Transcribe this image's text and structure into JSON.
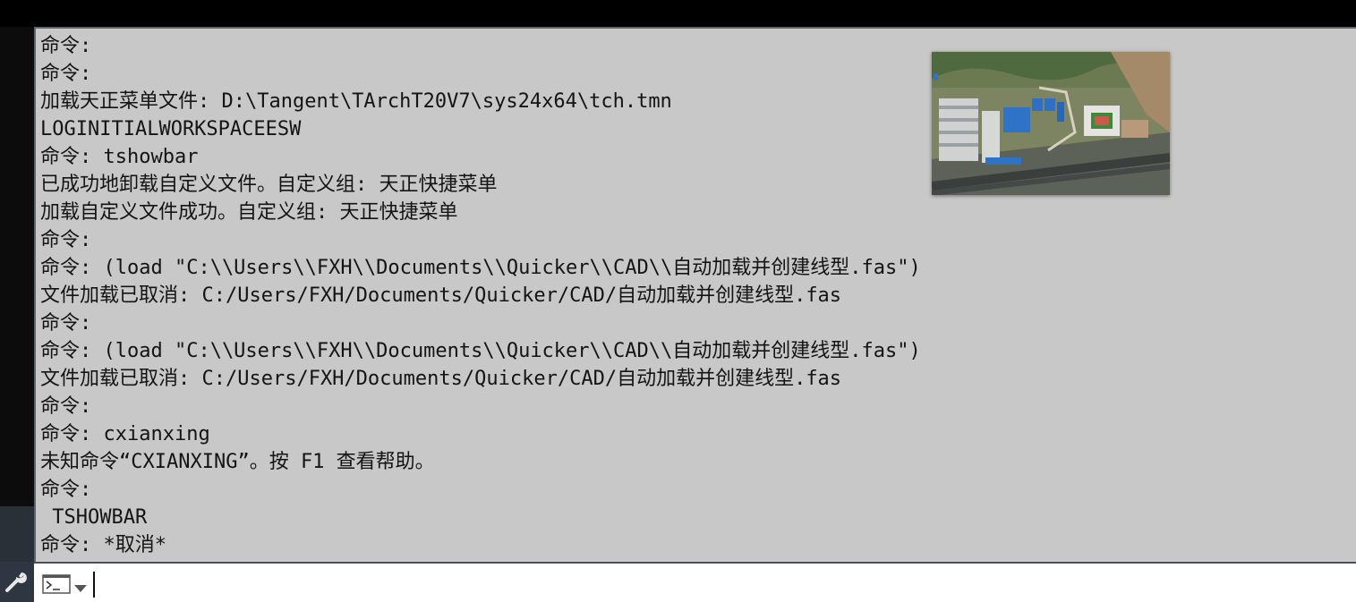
{
  "command_history": [
    "命令:",
    "命令:",
    "加载天正菜单文件: D:\\Tangent\\TArchT20V7\\sys24x64\\tch.tmn",
    "LOGINITIALWORKSPACEESW",
    "命令: tshowbar",
    "已成功地卸载自定义文件。自定义组: 天正快捷菜单",
    "加载自定义文件成功。自定义组: 天正快捷菜单",
    "命令:",
    "命令: (load \"C:\\\\Users\\\\FXH\\\\Documents\\\\Quicker\\\\CAD\\\\自动加载并创建线型.fas\")",
    "文件加载已取消: C:/Users/FXH/Documents/Quicker/CAD/自动加载并创建线型.fas",
    "命令:",
    "命令: (load \"C:\\\\Users\\\\FXH\\\\Documents\\\\Quicker\\\\CAD\\\\自动加载并创建线型.fas\")",
    "文件加载已取消: C:/Users/FXH/Documents/Quicker/CAD/自动加载并创建线型.fas",
    "命令:",
    "命令: cxianxing",
    "未知命令“CXIANXING”。按 F1 查看帮助。",
    "命令:",
    " TSHOWBAR",
    "命令: *取消*"
  ],
  "command_input": {
    "value": "",
    "placeholder": ""
  },
  "icons": {
    "left_tool": "wrench-icon",
    "prompt": "command-prompt-icon",
    "dropdown": "chevron-down-icon"
  },
  "colors": {
    "history_background": "#c8c8c8",
    "history_text": "#141414",
    "input_background": "#ffffff",
    "frame": "#000000"
  }
}
